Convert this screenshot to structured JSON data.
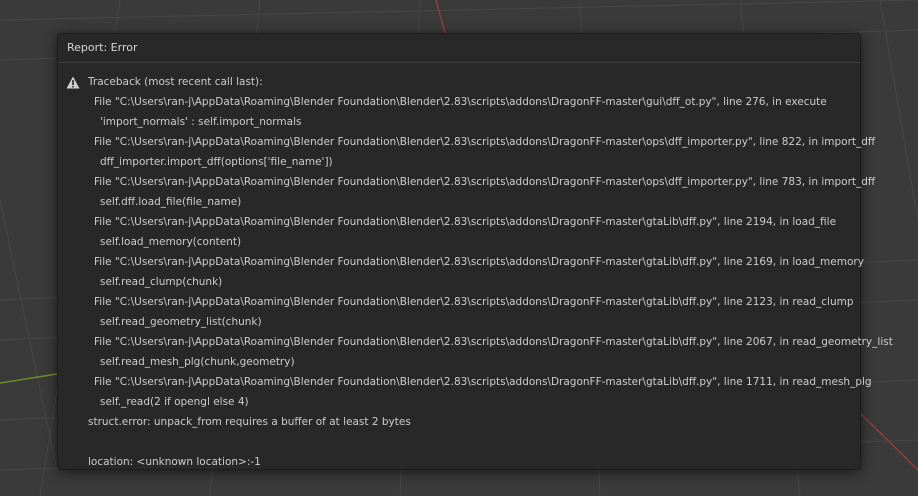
{
  "report": {
    "title": "Report: Error",
    "icon": "warning-icon",
    "traceback_header": "Traceback (most recent call last):",
    "frames": [
      {
        "file_line": "File \"C:\\Users\\ran-j\\AppData\\Roaming\\Blender Foundation\\Blender\\2.83\\scripts\\addons\\DragonFF-master\\gui\\dff_ot.py\", line 276, in execute",
        "code": "'import_normals' : self.import_normals"
      },
      {
        "file_line": "File \"C:\\Users\\ran-j\\AppData\\Roaming\\Blender Foundation\\Blender\\2.83\\scripts\\addons\\DragonFF-master\\ops\\dff_importer.py\", line 822, in import_dff",
        "code": "dff_importer.import_dff(options['file_name'])"
      },
      {
        "file_line": "File \"C:\\Users\\ran-j\\AppData\\Roaming\\Blender Foundation\\Blender\\2.83\\scripts\\addons\\DragonFF-master\\ops\\dff_importer.py\", line 783, in import_dff",
        "code": "self.dff.load_file(file_name)"
      },
      {
        "file_line": "File \"C:\\Users\\ran-j\\AppData\\Roaming\\Blender Foundation\\Blender\\2.83\\scripts\\addons\\DragonFF-master\\gtaLib\\dff.py\", line 2194, in load_file",
        "code": "self.load_memory(content)"
      },
      {
        "file_line": "File \"C:\\Users\\ran-j\\AppData\\Roaming\\Blender Foundation\\Blender\\2.83\\scripts\\addons\\DragonFF-master\\gtaLib\\dff.py\", line 2169, in load_memory",
        "code": "self.read_clump(chunk)"
      },
      {
        "file_line": "File \"C:\\Users\\ran-j\\AppData\\Roaming\\Blender Foundation\\Blender\\2.83\\scripts\\addons\\DragonFF-master\\gtaLib\\dff.py\", line 2123, in read_clump",
        "code": "self.read_geometry_list(chunk)"
      },
      {
        "file_line": "File \"C:\\Users\\ran-j\\AppData\\Roaming\\Blender Foundation\\Blender\\2.83\\scripts\\addons\\DragonFF-master\\gtaLib\\dff.py\", line 2067, in read_geometry_list",
        "code": "self.read_mesh_plg(chunk,geometry)"
      },
      {
        "file_line": "File \"C:\\Users\\ran-j\\AppData\\Roaming\\Blender Foundation\\Blender\\2.83\\scripts\\addons\\DragonFF-master\\gtaLib\\dff.py\", line 1711, in read_mesh_plg",
        "code": "self._read(2 if opengl else 4)"
      }
    ],
    "error": "struct.error: unpack_from requires a buffer of at least 2 bytes",
    "location": "location: <unknown location>:-1"
  }
}
